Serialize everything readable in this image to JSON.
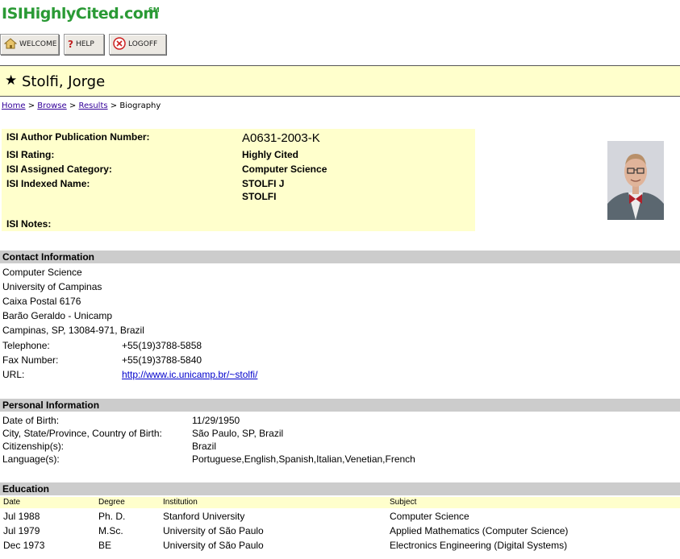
{
  "site": {
    "logo": "ISIHighlyCited.com",
    "service_mark": "SM"
  },
  "toolbar": {
    "welcome_label": "WELCOME",
    "help_label": "HELP",
    "logoff_label": "LOGOFF"
  },
  "page": {
    "title": "Stolfi, Jorge"
  },
  "breadcrumb": {
    "home": "Home",
    "browse": "Browse",
    "results": "Results",
    "current": "Biography",
    "separator": ">"
  },
  "isi": {
    "pub_number_label": "ISI Author Publication Number:",
    "pub_number": "A0631-2003-K",
    "rating_label": "ISI Rating:",
    "rating": "Highly Cited",
    "category_label": "ISI Assigned Category:",
    "category": "Computer Science",
    "indexed_name_label": "ISI Indexed Name:",
    "indexed_names": [
      "STOLFI J",
      "STOLFI"
    ],
    "notes_label": "ISI Notes:"
  },
  "contact": {
    "header": "Contact Information",
    "address_lines": [
      "Computer Science",
      "University of Campinas",
      "Caixa Postal 6176",
      "Barão Geraldo - Unicamp",
      "Campinas, SP, 13084-971, Brazil"
    ],
    "telephone_label": "Telephone:",
    "telephone": "+55(19)3788-5858",
    "fax_label": "Fax Number:",
    "fax": "+55(19)3788-5840",
    "url_label": "URL:",
    "url": "http://www.ic.unicamp.br/~stolfi/"
  },
  "personal": {
    "header": "Personal Information",
    "dob_label": "Date of Birth:",
    "dob": "11/29/1950",
    "birthplace_label": "City, State/Province, Country of Birth:",
    "birthplace": "São Paulo, SP, Brazil",
    "citizenship_label": "Citizenship(s):",
    "citizenship": "Brazil",
    "languages_label": "Language(s):",
    "languages": "Portuguese,English,Spanish,Italian,Venetian,French"
  },
  "education": {
    "header": "Education",
    "columns": [
      "Date",
      "Degree",
      "Institution",
      "Subject"
    ],
    "rows": [
      {
        "date": "Jul 1988",
        "degree": "Ph. D.",
        "institution": "Stanford University",
        "subject": "Computer Science"
      },
      {
        "date": "Jul 1979",
        "degree": "M.Sc.",
        "institution": "University of São Paulo",
        "subject": "Applied Mathematics (Computer Science)"
      },
      {
        "date": "Dec 1973",
        "degree": "BE",
        "institution": "University of São Paulo",
        "subject": "Electronics Engineering (Digital Systems)"
      }
    ]
  },
  "colors": {
    "brand_green": "#2a9a35",
    "highlight_yellow": "#ffffcc",
    "section_gray": "#cccccc",
    "link_blue": "#0000cc",
    "breadcrumb_link": "#330099"
  },
  "icons": {
    "welcome": "home-icon",
    "help": "question-icon",
    "logoff": "close-circle-icon",
    "title": "star-icon"
  }
}
